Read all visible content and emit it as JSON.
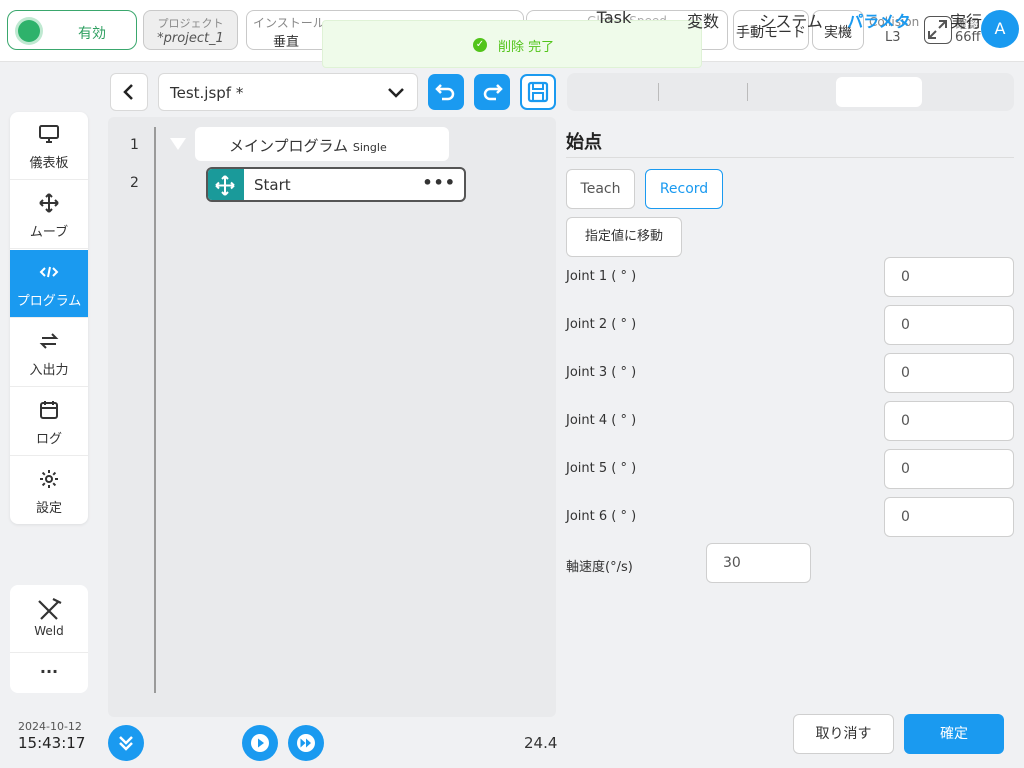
{
  "topbar": {
    "enable_label": "有効",
    "project_label": "プロジェクト",
    "project_name": "*project_1",
    "install_label": "インストール",
    "install_value": "垂直",
    "speed_label": "Global Speed",
    "manual_mode": "手動モード",
    "real_machine": "実機",
    "collision_label": "Collision",
    "collision_value": "L3",
    "confirm_label": "確認",
    "confirm_value": "66ff",
    "avatar_initial": "A"
  },
  "toast": {
    "message": "削除 完了"
  },
  "sidebar": {
    "items": [
      {
        "label": "儀表板",
        "icon": "monitor-icon"
      },
      {
        "label": "ムーブ",
        "icon": "move-arrows-icon"
      },
      {
        "label": "プログラム",
        "icon": "code-icon"
      },
      {
        "label": "入出力",
        "icon": "swap-icon"
      },
      {
        "label": "ログ",
        "icon": "calendar-icon"
      },
      {
        "label": "設定",
        "icon": "gear-icon"
      }
    ],
    "active_index": 2,
    "weld_label": "Weld",
    "more_label": "···"
  },
  "datetime": {
    "date": "2024-10-12",
    "time": "15:43:17"
  },
  "editor": {
    "file_name": "Test.jspf *",
    "line_numbers": [
      "1",
      "2"
    ],
    "main_node": "メインプログラム",
    "main_node_mode": "Single",
    "start_node": "Start",
    "start_more": "•••",
    "program_time": "24.4"
  },
  "tabs": {
    "items": [
      "Task",
      "変数",
      "システム",
      "パラメタ",
      "実行"
    ],
    "active_index": 3
  },
  "params": {
    "title": "始点",
    "teach_button": "Teach",
    "record_button": "Record",
    "move_to_value_button": "指定値に移動",
    "joints": [
      {
        "label": "Joint 1 ( ° )",
        "value": "0"
      },
      {
        "label": "Joint 2 ( ° )",
        "value": "0"
      },
      {
        "label": "Joint 3 ( ° )",
        "value": "0"
      },
      {
        "label": "Joint 4 ( ° )",
        "value": "0"
      },
      {
        "label": "Joint 5 ( ° )",
        "value": "0"
      },
      {
        "label": "Joint 6 ( ° )",
        "value": "0"
      }
    ],
    "speed_label": "軸速度(°/s)",
    "speed_value": "30",
    "cancel_button": "取り消す",
    "ok_button": "確定"
  },
  "colors": {
    "accent": "#1a9af0",
    "enable_green": "#2eb26b",
    "start_node_icon": "#1a9a9a",
    "toast_green": "#52c41a"
  }
}
